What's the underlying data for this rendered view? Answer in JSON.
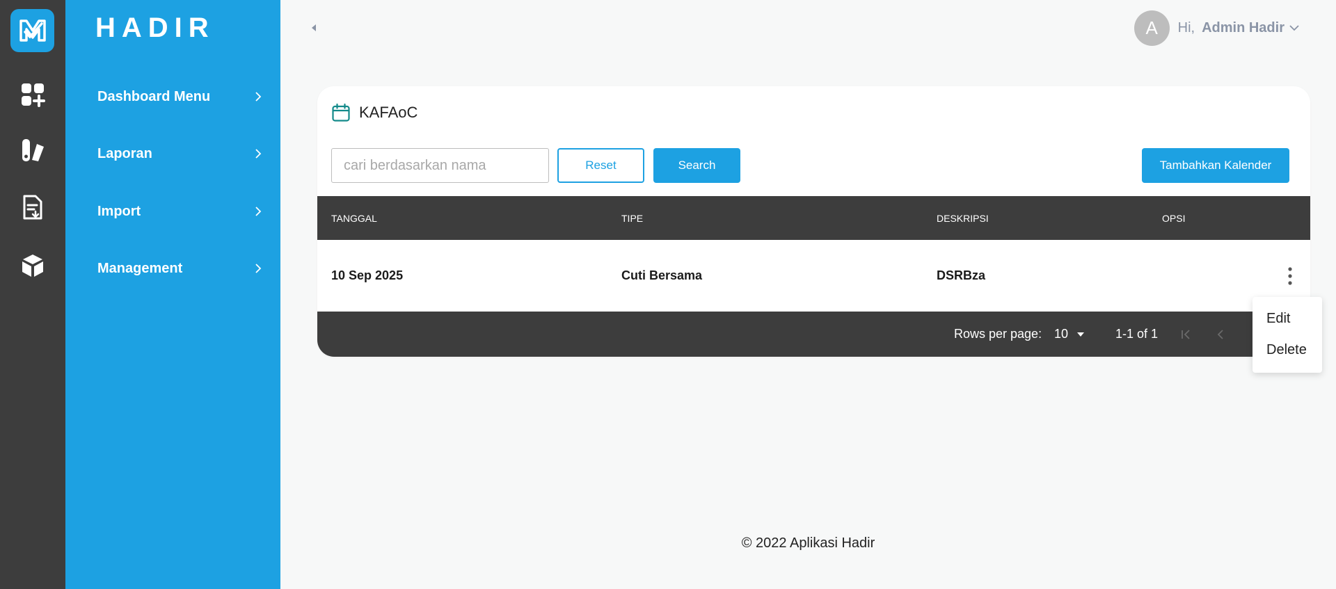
{
  "brand": {
    "name": "HADIR",
    "color": "#1da1e2"
  },
  "rail": {
    "icons": [
      "logo-icon",
      "dashboard-add-icon",
      "report-icon",
      "document-download-icon",
      "cube-icon"
    ]
  },
  "sidebar": {
    "items": [
      {
        "label": "Dashboard Menu",
        "icon": "chevron-right-icon"
      },
      {
        "label": "Laporan",
        "icon": "chevron-right-icon"
      },
      {
        "label": "Import",
        "icon": "chevron-right-icon"
      },
      {
        "label": "Management",
        "icon": "chevron-right-icon"
      }
    ]
  },
  "header": {
    "avatar_letter": "A",
    "greeting": "Hi,",
    "user_name": "Admin Hadir"
  },
  "card": {
    "title": "KAFAoC",
    "search_placeholder": "cari berdasarkan nama",
    "search_value": "",
    "reset_label": "Reset",
    "search_label": "Search",
    "add_label": "Tambahkan Kalender"
  },
  "table": {
    "columns": [
      "TANGGAL",
      "TIPE",
      "DESKRIPSI",
      "OPSI"
    ],
    "rows": [
      {
        "tanggal": "10 Sep 2025",
        "tipe": "Cuti Bersama",
        "deskripsi": "DSRBza"
      }
    ],
    "footer": {
      "rows_per_page_label": "Rows per page:",
      "rows_per_page_value": "10",
      "range": "1-1 of 1"
    }
  },
  "row_menu": {
    "edit": "Edit",
    "delete": "Delete"
  },
  "footer": {
    "text": "© 2022 Aplikasi Hadir"
  },
  "colors": {
    "accent": "#1da1e2",
    "dark": "#3d3d3d",
    "background": "#f7f8f8"
  }
}
